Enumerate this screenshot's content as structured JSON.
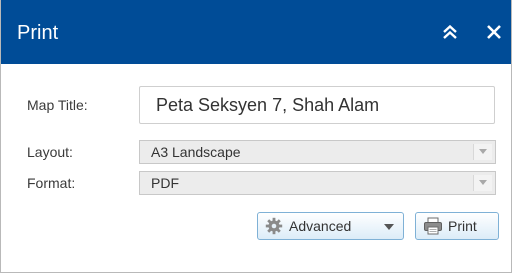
{
  "window": {
    "title": "Print",
    "title_bar_color": "#004c97",
    "collapse_icon": "double-chevron-up-icon",
    "close_icon": "close-icon"
  },
  "form": {
    "map_title": {
      "label": "Map Title:",
      "value": "Peta Seksyen 7, Shah Alam"
    },
    "layout": {
      "label": "Layout:",
      "selected": "A3 Landscape"
    },
    "format": {
      "label": "Format:",
      "selected": "PDF"
    }
  },
  "buttons": {
    "advanced": {
      "label": "Advanced",
      "icon": "gear-icon"
    },
    "print": {
      "label": "Print",
      "icon": "printer-icon"
    }
  }
}
